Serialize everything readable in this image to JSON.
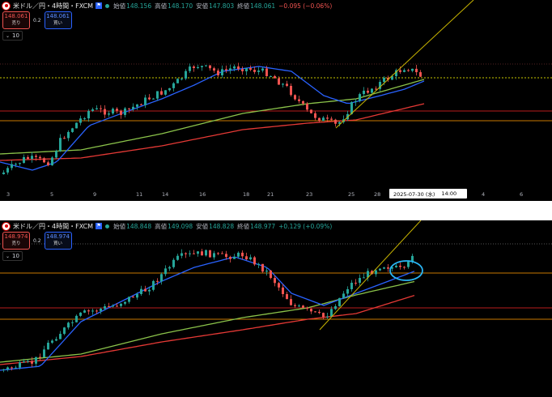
{
  "top": {
    "symbol": "米ドル／円・4時間・FXCM",
    "labels": {
      "open": "始値",
      "high": "高値",
      "low": "安値",
      "close": "終値"
    },
    "open": "148.156",
    "high": "148.170",
    "low": "147.803",
    "close": "148.061",
    "change": "−0.095 (−0.06%)",
    "sell_price": "148.061",
    "sell_label": "売り",
    "buy_price": "148.061",
    "buy_label": "買い",
    "spread": "0.2",
    "counter": "10",
    "x_ticks": [
      "3",
      "5",
      "9",
      "11",
      "14",
      "16",
      "18",
      "21",
      "23",
      "25",
      "28",
      "4",
      "6"
    ],
    "tooltip_date": "2025-07-30 (水)",
    "tooltip_time": "14:00"
  },
  "bottom": {
    "symbol": "米ドル／円・4時間・FXCM",
    "labels": {
      "open": "始値",
      "high": "高値",
      "low": "安値",
      "close": "終値"
    },
    "open": "148.848",
    "high": "149.098",
    "low": "148.828",
    "close": "148.977",
    "change": "+0.129 (+0.09%)",
    "sell_price": "148.974",
    "sell_label": "売り",
    "buy_price": "148.974",
    "buy_label": "買い",
    "spread": "0.2",
    "counter": "10"
  },
  "colors": {
    "up": "#26a69a",
    "down": "#ef5350",
    "ma_short": "#2962ff",
    "ma_mid": "#8bc34a",
    "ma_long": "#e53935",
    "trend": "#c8b400",
    "hline_red": "#b71c1c",
    "hline_orange": "#c77800",
    "dotted": "#c8c800",
    "highlight": "#29b6f6"
  },
  "chart_data": [
    {
      "type": "candlestick",
      "title": "米ドル／円・4時間・FXCM",
      "last_close": 148.061,
      "x_tick_labels": [
        "3",
        "5",
        "9",
        "11",
        "14",
        "16",
        "18",
        "21",
        "23",
        "25",
        "28",
        "4",
        "6"
      ],
      "trend": "rising from low near 146 to high near 148.7, pullback, recovery",
      "indicators": [
        "moving average (blue)",
        "moving average (green)",
        "moving average (red)",
        "trendline (yellow)"
      ]
    },
    {
      "type": "candlestick",
      "title": "米ドル／円・4時間・FXCM",
      "last_close": 148.977,
      "annotation": "circle around latest reversal candles",
      "indicators": [
        "moving average (blue)",
        "moving average (green)",
        "moving average (red)",
        "trendline (yellow)"
      ]
    }
  ]
}
